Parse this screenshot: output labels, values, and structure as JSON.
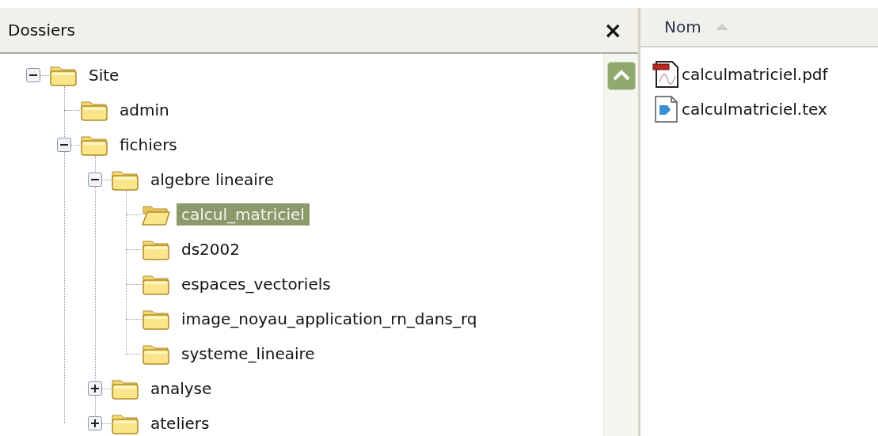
{
  "folders_pane": {
    "title": "Dossiers",
    "close": "×",
    "tree": [
      {
        "label": "Site",
        "expanded": true,
        "selected": false,
        "children": [
          {
            "label": "admin",
            "selected": false
          },
          {
            "label": "fichiers",
            "expanded": true,
            "selected": false,
            "children": [
              {
                "label": "algebre lineaire",
                "expanded": true,
                "selected": false,
                "children": [
                  {
                    "label": "calcul_matriciel",
                    "selected": true
                  },
                  {
                    "label": "ds2002",
                    "selected": false
                  },
                  {
                    "label": "espaces_vectoriels",
                    "selected": false
                  },
                  {
                    "label": "image_noyau_application_rn_dans_rq",
                    "selected": false
                  },
                  {
                    "label": "systeme_lineaire",
                    "selected": false
                  }
                ]
              },
              {
                "label": "analyse",
                "expanded": false,
                "selected": false
              },
              {
                "label": "ateliers",
                "expanded": false,
                "selected": false
              }
            ]
          }
        ]
      }
    ]
  },
  "files_pane": {
    "columns": [
      {
        "label": "Nom",
        "sorted_ascending": true
      }
    ],
    "files": [
      {
        "name": "calculmatriciel.pdf",
        "kind": "pdf"
      },
      {
        "name": "calculmatriciel.tex",
        "kind": "tex"
      }
    ]
  }
}
